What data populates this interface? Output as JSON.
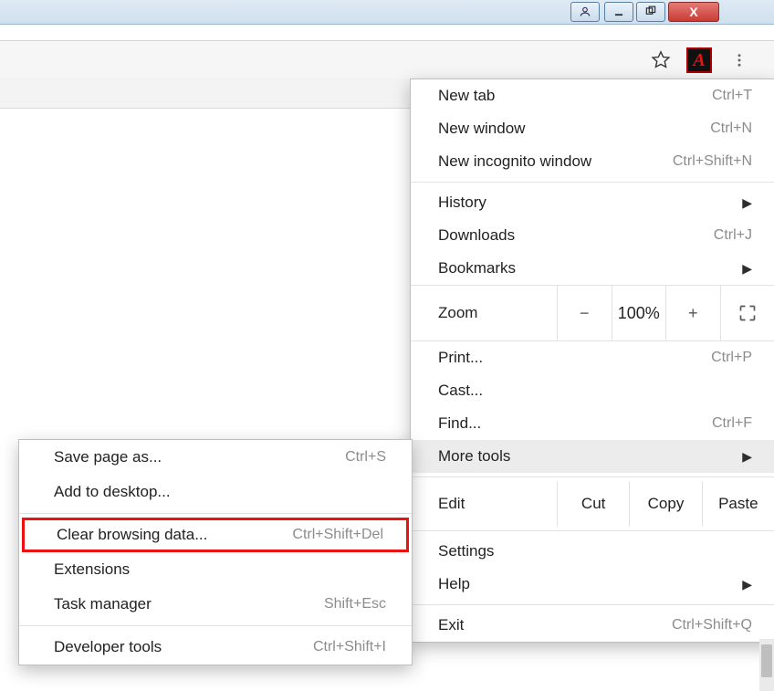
{
  "titlebar": {
    "close_glyph": "X"
  },
  "toolbar": {
    "adobe_glyph": "A"
  },
  "menu": {
    "new_tab": {
      "label": "New tab",
      "shortcut": "Ctrl+T"
    },
    "new_window": {
      "label": "New window",
      "shortcut": "Ctrl+N"
    },
    "new_incognito": {
      "label": "New incognito window",
      "shortcut": "Ctrl+Shift+N"
    },
    "history": {
      "label": "History"
    },
    "downloads": {
      "label": "Downloads",
      "shortcut": "Ctrl+J"
    },
    "bookmarks": {
      "label": "Bookmarks"
    },
    "zoom": {
      "label": "Zoom",
      "minus": "−",
      "value": "100%",
      "plus": "+"
    },
    "print": {
      "label": "Print...",
      "shortcut": "Ctrl+P"
    },
    "cast": {
      "label": "Cast..."
    },
    "find": {
      "label": "Find...",
      "shortcut": "Ctrl+F"
    },
    "more_tools": {
      "label": "More tools"
    },
    "edit": {
      "label": "Edit",
      "cut": "Cut",
      "copy": "Copy",
      "paste": "Paste"
    },
    "settings": {
      "label": "Settings"
    },
    "help": {
      "label": "Help"
    },
    "exit": {
      "label": "Exit",
      "shortcut": "Ctrl+Shift+Q"
    }
  },
  "submenu": {
    "save_page_as": {
      "label": "Save page as...",
      "shortcut": "Ctrl+S"
    },
    "add_to_desktop": {
      "label": "Add to desktop..."
    },
    "clear_browsing": {
      "label": "Clear browsing data...",
      "shortcut": "Ctrl+Shift+Del"
    },
    "extensions": {
      "label": "Extensions"
    },
    "task_manager": {
      "label": "Task manager",
      "shortcut": "Shift+Esc"
    },
    "developer_tools": {
      "label": "Developer tools",
      "shortcut": "Ctrl+Shift+I"
    }
  }
}
